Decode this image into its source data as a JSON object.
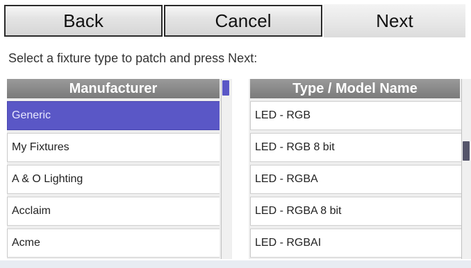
{
  "toolbar": {
    "back_label": "Back",
    "cancel_label": "Cancel",
    "next_label": "Next"
  },
  "instruction": "Select a fixture type to patch and press Next:",
  "manufacturer_list": {
    "header": "Manufacturer",
    "selected_index": 0,
    "items": [
      {
        "label": "Generic"
      },
      {
        "label": "My Fixtures"
      },
      {
        "label": "A & O Lighting"
      },
      {
        "label": "Acclaim"
      },
      {
        "label": "Acme"
      }
    ]
  },
  "type_list": {
    "header": "Type / Model Name",
    "items": [
      {
        "label": "LED - RGB"
      },
      {
        "label": "LED - RGB 8 bit"
      },
      {
        "label": "LED - RGBA"
      },
      {
        "label": "LED - RGBA 8 bit"
      },
      {
        "label": "LED - RGBAI"
      }
    ]
  },
  "colors": {
    "selection": "#5a57c6",
    "header_bg": "#8a8a8a"
  }
}
